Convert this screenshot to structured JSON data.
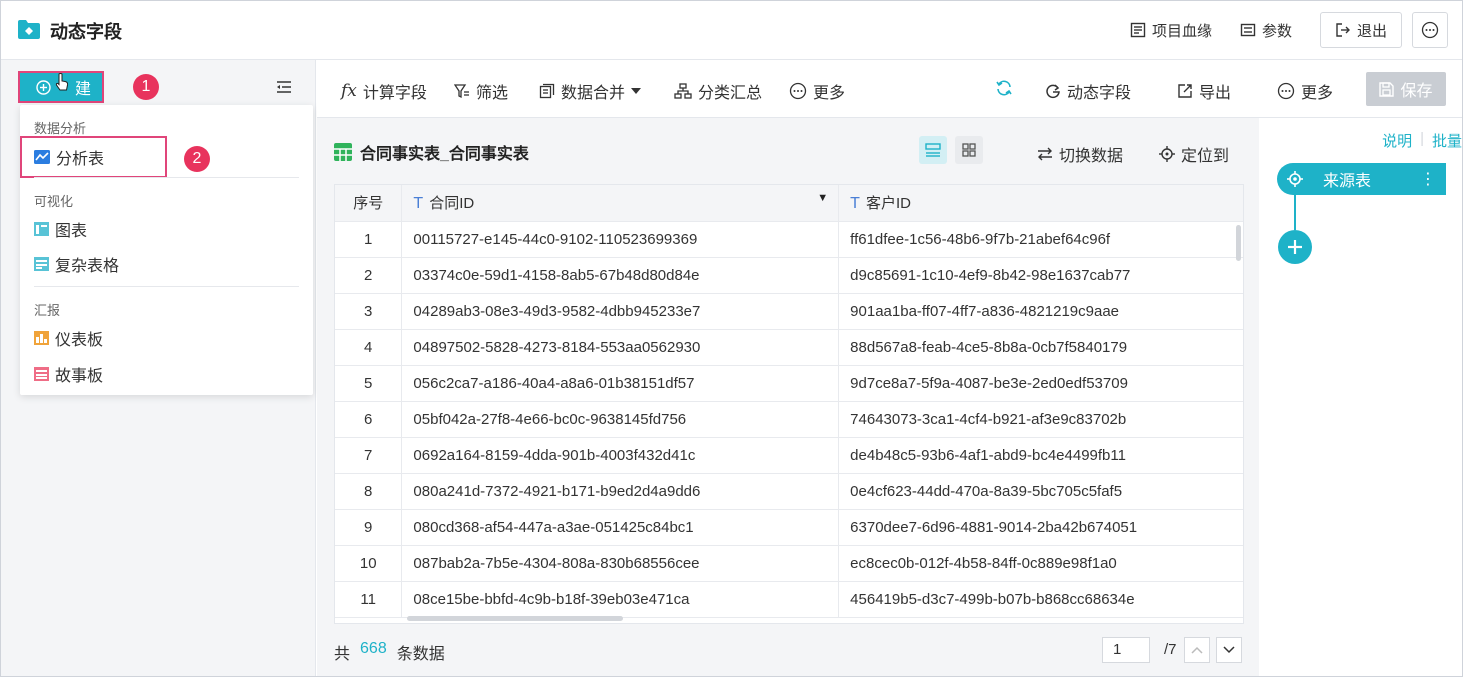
{
  "app": {
    "title": "动态字段",
    "icon": "folder-icon"
  },
  "header": {
    "lineage": "项目血缘",
    "params": "参数",
    "exit": "退出"
  },
  "left": {
    "new_label": "建",
    "badge1": "1",
    "badge2": "2",
    "menu": {
      "group1": "数据分析",
      "item_analysis": "分析表",
      "group2": "可视化",
      "item_chart": "图表",
      "item_complex": "复杂表格",
      "group3": "汇报",
      "item_dashboard": "仪表板",
      "item_story": "故事板"
    }
  },
  "toolbar": {
    "calc_field": "计算字段",
    "filter": "筛选",
    "merge": "数据合并",
    "group_summary": "分类汇总",
    "more": "更多",
    "dynamic_field": "动态字段",
    "export": "导出",
    "more2": "更多",
    "save": "保存"
  },
  "main": {
    "table_title": "合同事实表_合同事实表",
    "switch_data": "切换数据",
    "locate": "定位到",
    "columns": [
      "序号",
      "合同ID",
      "客户ID"
    ],
    "rows": [
      [
        "1",
        "00115727-e145-44c0-9102-110523699369",
        "ff61dfee-1c56-48b6-9f7b-21abef64c96f"
      ],
      [
        "2",
        "03374c0e-59d1-4158-8ab5-67b48d80d84e",
        "d9c85691-1c10-4ef9-8b42-98e1637cab77"
      ],
      [
        "3",
        "04289ab3-08e3-49d3-9582-4dbb945233e7",
        "901aa1ba-ff07-4ff7-a836-4821219c9aae"
      ],
      [
        "4",
        "04897502-5828-4273-8184-553aa0562930",
        "88d567a8-feab-4ce5-8b8a-0cb7f5840179"
      ],
      [
        "5",
        "056c2ca7-a186-40a4-a8a6-01b38151df57",
        "9d7ce8a7-5f9a-4087-be3e-2ed0edf53709"
      ],
      [
        "6",
        "05bf042a-27f8-4e66-bc0c-9638145fd756",
        "74643073-3ca1-4cf4-b921-af3e9c83702b"
      ],
      [
        "7",
        "0692a164-8159-4dda-901b-4003f432d41c",
        "de4b48c5-93b6-4af1-abd9-bc4e4499fb11"
      ],
      [
        "8",
        "080a241d-7372-4921-b171-b9ed2d4a9dd6",
        "0e4cf623-44dd-470a-8a39-5bc705c5faf5"
      ],
      [
        "9",
        "080cd368-af54-447a-a3ae-051425c84bc1",
        "6370dee7-6d96-4881-9014-2ba42b674051"
      ],
      [
        "10",
        "087bab2a-7b5e-4304-808a-830b68556cee",
        "ec8cec0b-012f-4b58-84ff-0c889e98f1a0"
      ],
      [
        "11",
        "08ce15be-bbfd-4c9b-b18f-39eb03e471ca",
        "456419b5-d3c7-499b-b07b-b868cc68634e"
      ]
    ],
    "footer_prefix": "共",
    "footer_count": "668",
    "footer_suffix": "条数据",
    "page_current": "1",
    "page_total": "/7"
  },
  "right": {
    "explain": "说明",
    "batch": "批量",
    "source_node": "来源表"
  },
  "colors": {
    "accent": "#1eb2c8",
    "annotation": "#e0457a",
    "badge": "#e8335d"
  }
}
